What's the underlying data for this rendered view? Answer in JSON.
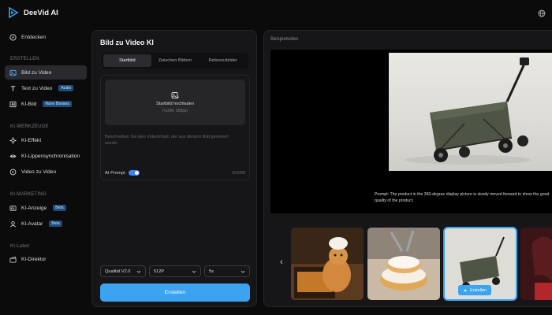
{
  "brand": {
    "name": "DeeVid AI"
  },
  "sidebar": {
    "top_item": {
      "label": "Entdecken"
    },
    "sections": [
      {
        "title": "ERSTELLEN"
      },
      {
        "title": "KI-WERKZEUGE"
      },
      {
        "title": "KI-MARKETING"
      },
      {
        "title": "KI-Labor"
      }
    ],
    "items": [
      {
        "label": "Bild zu Video",
        "icon": "image-icon",
        "active": true
      },
      {
        "label": "Text zu Video",
        "badge": "Audio",
        "icon": "text-icon"
      },
      {
        "label": "KI-Bild",
        "badge": "Nano Banana",
        "icon": "ai-image-icon"
      },
      {
        "label": "KI-Effekt",
        "icon": "sparkle-icon"
      },
      {
        "label": "KI-Lippensynchronisation",
        "icon": "lips-icon"
      },
      {
        "label": "Video zu Video",
        "icon": "video-icon"
      },
      {
        "label": "KI-Anzeige",
        "badge": "Beta",
        "icon": "ad-icon"
      },
      {
        "label": "KI-Avatar",
        "badge": "Beta",
        "icon": "avatar-icon"
      },
      {
        "label": "KI-Direktor",
        "icon": "clapper-icon"
      }
    ]
  },
  "panel": {
    "title": "Bild zu Video KI",
    "tabs": [
      {
        "label": "Startbild",
        "active": true
      },
      {
        "label": "Zwischen Bildern"
      },
      {
        "label": "Referenzbilder"
      }
    ],
    "upload": {
      "title": "Startbild hochladen",
      "hint": "(<10M, 300px)"
    },
    "description_placeholder": "Beschreiben Sie den Videoinhalt, der aus diesem Bild generiert wurde.",
    "ai_prompt_label": "AI Prompt",
    "ai_prompt_enabled": true,
    "char_count": "0/2000",
    "quality": {
      "value": "Qualität V2.0"
    },
    "resolution": {
      "value": "512P"
    },
    "duration": {
      "value": "5s"
    },
    "create_label": "Erstellen"
  },
  "example": {
    "label": "Beispielvideo",
    "prompt": "Prompt:   The product in the 360-degree display picture is slowly moved forward to show the good quality of the product.",
    "thumbs": [
      {
        "icon": "cat-chef-thumbnail"
      },
      {
        "icon": "donut-thumbnail"
      },
      {
        "icon": "wagon-thumbnail",
        "selected": true,
        "chip": "Erstellen"
      },
      {
        "icon": "woman-portrait-thumbnail"
      }
    ]
  },
  "colors": {
    "accent": "#3ba3f0",
    "background": "#0b0b0c",
    "panel": "#161618"
  }
}
